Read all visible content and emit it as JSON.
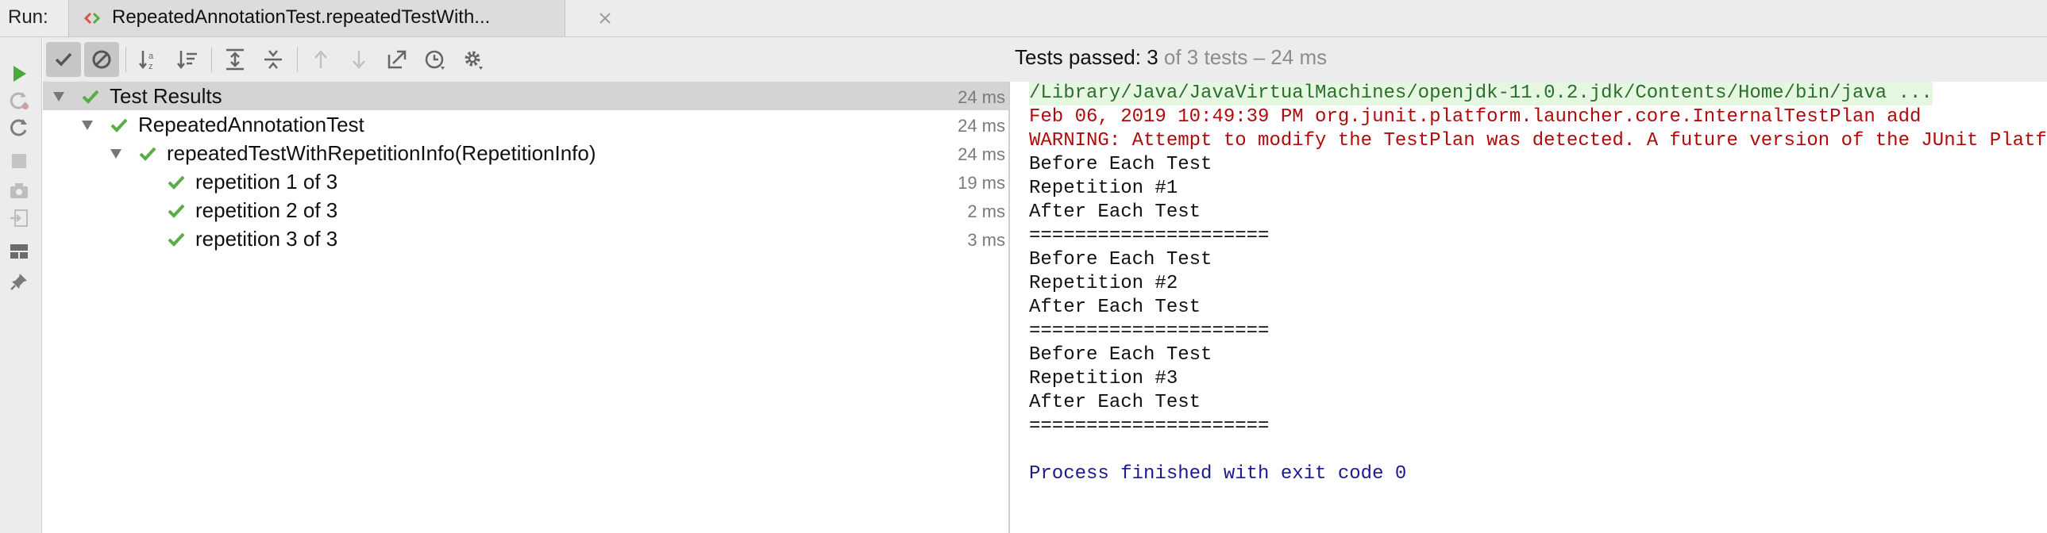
{
  "tabbar": {
    "run_label": "Run:",
    "tab_title": "RepeatedAnnotationTest.repeatedTestWith..."
  },
  "sidebar": {
    "icons": [
      "run-icon",
      "rerun-failed-icon",
      "rerun-icon",
      "stop-icon",
      "screenshot-icon",
      "import-icon",
      "layout-icon",
      "pin-icon"
    ]
  },
  "toolbar": {
    "icons": [
      "show-passed-icon",
      "show-ignored-icon",
      "sort-alpha-icon",
      "sort-duration-icon",
      "expand-all-icon",
      "collapse-all-icon",
      "prev-failed-icon",
      "next-failed-icon",
      "export-icon",
      "history-icon",
      "settings-icon"
    ],
    "summary_prefix": "Tests passed: ",
    "summary_count": "3",
    "summary_rest": " of 3 tests – 24 ms"
  },
  "tree": {
    "rows": [
      {
        "label": "Test Results",
        "duration": "24 ms"
      },
      {
        "label": "RepeatedAnnotationTest",
        "duration": "24 ms"
      },
      {
        "label": "repeatedTestWithRepetitionInfo(RepetitionInfo)",
        "duration": "24 ms"
      },
      {
        "label": "repetition 1 of 3",
        "duration": "19 ms"
      },
      {
        "label": "repetition 2 of 3",
        "duration": "2 ms"
      },
      {
        "label": "repetition 3 of 3",
        "duration": "3 ms"
      }
    ]
  },
  "console": {
    "lines": [
      "/Library/Java/JavaVirtualMachines/openjdk-11.0.2.jdk/Contents/Home/bin/java ...",
      "Feb 06, 2019 10:49:39 PM org.junit.platform.launcher.core.InternalTestPlan add",
      "WARNING: Attempt to modify the TestPlan was detected. A future version of the JUnit Platform",
      "Before Each Test",
      "Repetition #1",
      "After Each Test",
      "=====================",
      "Before Each Test",
      "Repetition #2",
      "After Each Test",
      "=====================",
      "Before Each Test",
      "Repetition #3",
      "After Each Test",
      "=====================",
      "",
      "Process finished with exit code 0"
    ]
  },
  "colors": {
    "pass_green": "#5aac44",
    "error_red": "#b00a0a",
    "exit_blue": "#1a1a8c"
  }
}
